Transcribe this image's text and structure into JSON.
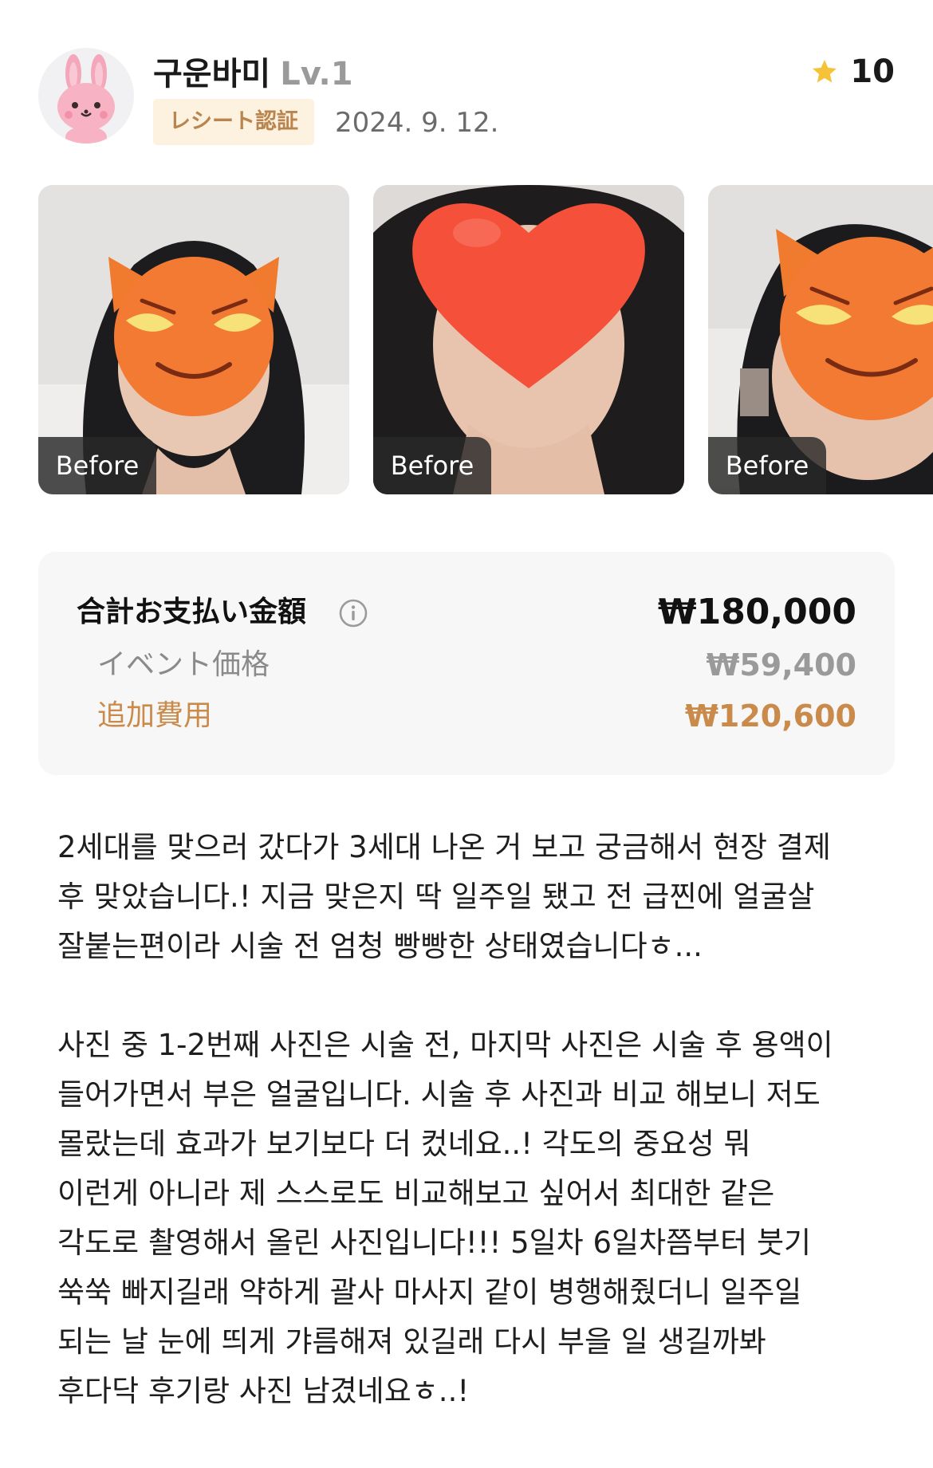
{
  "header": {
    "user_name": "구운바미",
    "user_level": "Lv.1",
    "receipt_badge": "レシート認証",
    "date": "2024. 9. 12.",
    "rating": "10",
    "rating_icon": "star-icon",
    "avatar_icon": "bunny-avatar-icon"
  },
  "photos": [
    {
      "label": "Before",
      "cover_icon": "devil-emoji-icon"
    },
    {
      "label": "Before",
      "cover_icon": "heart-icon"
    },
    {
      "label": "Before",
      "cover_icon": "devil-emoji-icon"
    }
  ],
  "price": {
    "total_label": "合計お支払い金額",
    "total_value": "₩180,000",
    "info_icon": "info-icon",
    "event_label": "イベント価格",
    "event_value": "₩59,400",
    "extra_label": "追加費用",
    "extra_value": "₩120,600"
  },
  "review": {
    "paragraph1": "2세대를 맞으러 갔다가 3세대 나온 거 보고 궁금해서 현장 결제\n후 맞았습니다.! 지금 맞은지 딱 일주일 됐고 전 급찐에 얼굴살\n잘붙는편이라 시술 전 엄청 빵빵한 상태였습니다ㅎ...",
    "paragraph2": "사진 중 1-2번째 사진은 시술 전, 마지막 사진은 시술 후 용액이\n들어가면서 부은 얼굴입니다. 시술 후 사진과 비교 해보니 저도\n몰랐는데 효과가 보기보다 더 컸네요..! 각도의 중요성 뭐\n이런게 아니라 제 스스로도 비교해보고 싶어서 최대한 같은\n각도로 촬영해서 올린 사진입니다!!! 5일차 6일차쯤부터 붓기\n쑥쑥 빠지길래 약하게 괄사 마사지 같이 병행해줬더니 일주일\n되는 날 눈에 띄게 갸름해져 있길래 다시 부을 일 생길까봐\n후다닥 후기랑 사진 남겼네요ㅎ..!"
  },
  "colors": {
    "badge_bg": "#fdf1df",
    "badge_text": "#b8854e",
    "extra_cost": "#c98a4a",
    "star": "#f6c338",
    "price_box_bg": "#f7f7f7"
  }
}
